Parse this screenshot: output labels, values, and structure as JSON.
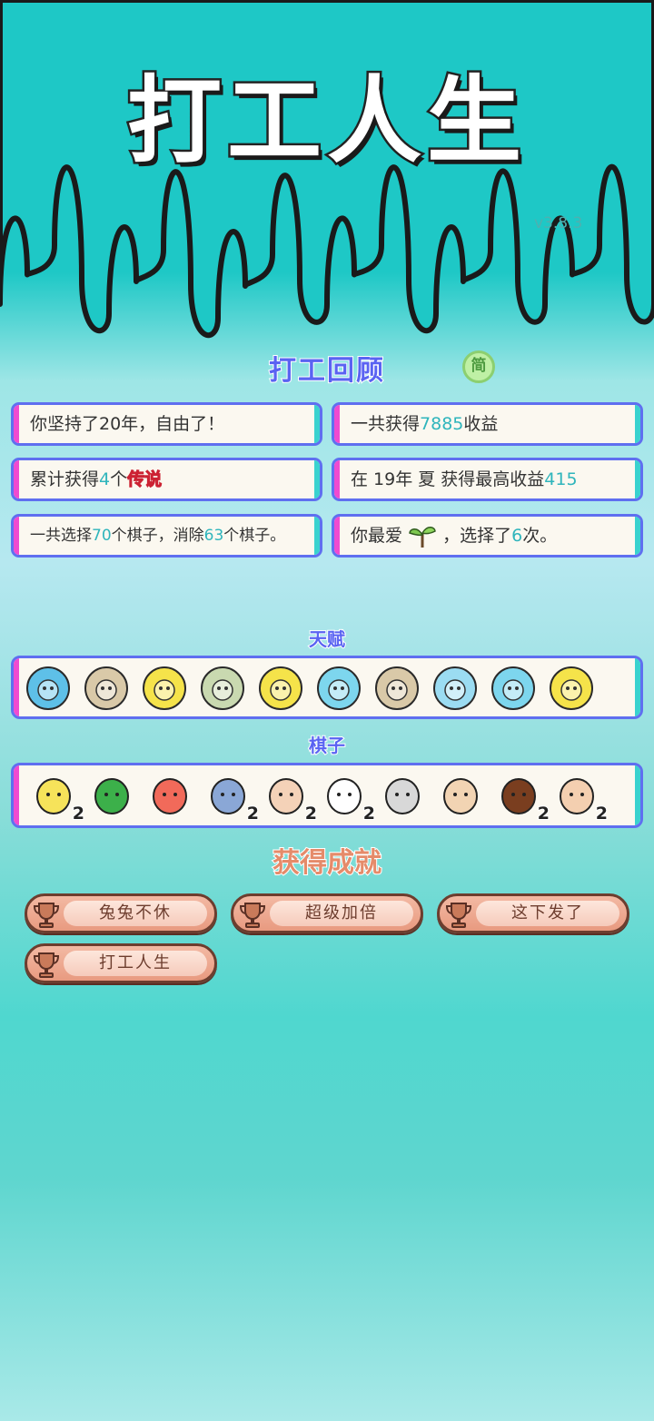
{
  "app": {
    "title": "打工人生",
    "version": "v3.8.3"
  },
  "review": {
    "title": "打工回顾",
    "lang_button": "简",
    "stats": [
      {
        "parts": [
          "你坚持了20年，自由了！"
        ]
      },
      {
        "parts": [
          "一共获得",
          "7885",
          "收益"
        ]
      },
      {
        "parts": [
          "累计获得",
          "4",
          "个",
          "传说"
        ]
      },
      {
        "parts": [
          "在 19年 夏 获得最高收益",
          "415"
        ]
      },
      {
        "parts": [
          "一共选择",
          "70",
          "个棋子，消除",
          "63",
          "个棋子。"
        ]
      },
      {
        "parts": [
          "你最爱",
          "，选择了",
          "6",
          "次。"
        ],
        "icon": "sprout-icon"
      }
    ]
  },
  "talents": {
    "title": "天赋",
    "items": [
      {
        "icon": "owl-coin-icon",
        "color": "#5ec0e8"
      },
      {
        "icon": "milk-tea-icon",
        "color": "#d9c9a8"
      },
      {
        "icon": "fruit-basket-icon",
        "color": "#f5e34a"
      },
      {
        "icon": "recycle-icon",
        "color": "#c9d9b0"
      },
      {
        "icon": "film-reel-icon",
        "color": "#f5e34a"
      },
      {
        "icon": "heart-sign-icon",
        "color": "#7dd6ee"
      },
      {
        "icon": "hammer-icon",
        "color": "#d9c9a8"
      },
      {
        "icon": "husky-coin-icon",
        "color": "#9bdcf2"
      },
      {
        "icon": "piggy-bank-icon",
        "color": "#7dd6ee"
      },
      {
        "icon": "leaf-coin-icon",
        "color": "#f5e34a"
      }
    ]
  },
  "pieces": {
    "title": "棋子",
    "items": [
      {
        "icon": "yellow-chick-icon",
        "count": "2"
      },
      {
        "icon": "watermelon-icon",
        "count": ""
      },
      {
        "icon": "koi-fish-icon",
        "count": ""
      },
      {
        "icon": "graphics-card-icon",
        "count": "2"
      },
      {
        "icon": "girl-face-icon",
        "count": "2"
      },
      {
        "icon": "husky-king-icon",
        "count": "2"
      },
      {
        "icon": "pointing-hand-icon",
        "count": ""
      },
      {
        "icon": "green-hat-man-icon",
        "count": ""
      },
      {
        "icon": "dark-hand-icon",
        "count": "2"
      },
      {
        "icon": "bald-man-icon",
        "count": "2"
      }
    ]
  },
  "achievements": {
    "title": "获得成就",
    "items": [
      "兔兔不休",
      "超级加倍",
      "这下发了",
      "打工人生"
    ]
  }
}
